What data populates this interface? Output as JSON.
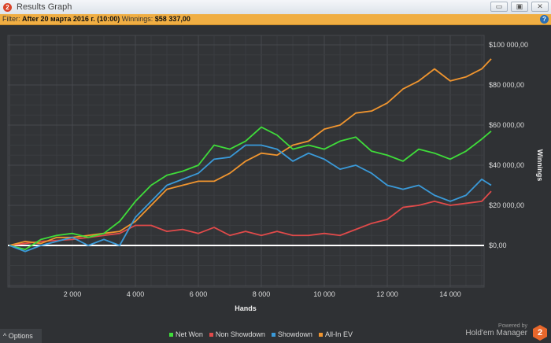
{
  "window": {
    "title": "Results Graph",
    "minimize": "▭",
    "maximize": "▣",
    "close": "✕"
  },
  "filter": {
    "label": "Filter:",
    "value": "After 20 марта 2016 г. (10:00)",
    "winnings_label": "Winnings:",
    "winnings_value": "$58 337,00",
    "help": "?"
  },
  "options_label": "^  Options",
  "powered": {
    "line1": "Powered by",
    "line2": "Hold'em Manager",
    "badge": "2"
  },
  "chart_data": {
    "type": "line",
    "xlabel": "Hands",
    "ylabel": "Winnings",
    "xlim": [
      0,
      15300
    ],
    "ylim": [
      -20000,
      110000
    ],
    "x_ticks": [
      2000,
      4000,
      6000,
      8000,
      10000,
      12000,
      14000
    ],
    "x_tick_labels": [
      "2 000",
      "4 000",
      "6 000",
      "8 000",
      "10 000",
      "12 000",
      "14 000"
    ],
    "y_ticks": [
      0,
      20000,
      40000,
      60000,
      80000,
      100000
    ],
    "y_tick_labels": [
      "$0,00",
      "$20 000,00",
      "$40 000,00",
      "$60 000,00",
      "$80 000,00",
      "$100 000,00"
    ],
    "x": [
      0,
      500,
      1000,
      1500,
      2000,
      2500,
      3000,
      3500,
      4000,
      4500,
      5000,
      5500,
      6000,
      6500,
      7000,
      7500,
      8000,
      8500,
      9000,
      9500,
      10000,
      10500,
      11000,
      11500,
      12000,
      12500,
      13000,
      13500,
      14000,
      14500,
      15000,
      15300
    ],
    "series": [
      {
        "name": "Net Won",
        "color": "#3fdc3a",
        "values": [
          0,
          -2000,
          3000,
          5000,
          6000,
          4000,
          6000,
          12000,
          22000,
          30000,
          35000,
          37000,
          40000,
          50000,
          48000,
          52000,
          59000,
          55000,
          48000,
          50000,
          48000,
          52000,
          54000,
          47000,
          45000,
          42000,
          48000,
          46000,
          43000,
          47000,
          53000,
          57000
        ]
      },
      {
        "name": "Non Showdown",
        "color": "#e04a4a",
        "values": [
          0,
          1000,
          2000,
          2500,
          3000,
          4000,
          5000,
          6000,
          10000,
          10000,
          7000,
          8000,
          6000,
          9000,
          5000,
          7000,
          5000,
          7000,
          5000,
          5000,
          6000,
          5000,
          8000,
          11000,
          13000,
          19000,
          20000,
          22000,
          20000,
          21000,
          22000,
          27000
        ]
      },
      {
        "name": "Showdown",
        "color": "#3a9ad9",
        "values": [
          0,
          -3000,
          0,
          2000,
          4000,
          0,
          3000,
          0,
          14000,
          22000,
          30000,
          33000,
          36000,
          43000,
          44000,
          50000,
          50000,
          48000,
          42000,
          46000,
          43000,
          38000,
          40000,
          36000,
          30000,
          28000,
          30000,
          25000,
          22000,
          25000,
          33000,
          30000
        ]
      },
      {
        "name": "All-In EV",
        "color": "#f0952f",
        "values": [
          0,
          2000,
          1000,
          4000,
          4000,
          5000,
          6000,
          7000,
          12000,
          20000,
          28000,
          30000,
          32000,
          32000,
          36000,
          42000,
          46000,
          45000,
          50000,
          52000,
          58000,
          60000,
          66000,
          67000,
          71000,
          78000,
          82000,
          88000,
          82000,
          84000,
          88000,
          93000
        ]
      }
    ]
  }
}
